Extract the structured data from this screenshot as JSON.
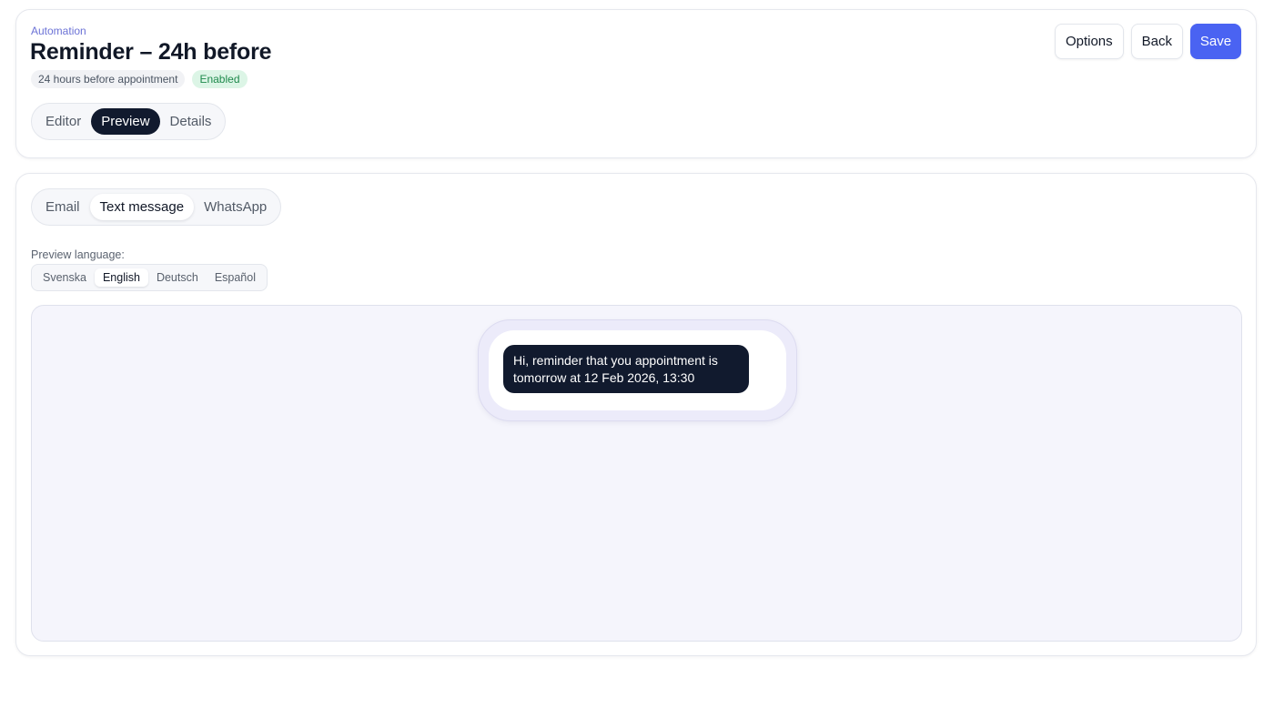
{
  "header": {
    "eyebrow": "Automation",
    "title": "Reminder – 24h before",
    "timing_chip": "24 hours before appointment",
    "status_badge": "Enabled",
    "view_tabs": [
      {
        "label": "Editor",
        "active": false
      },
      {
        "label": "Preview",
        "active": true
      },
      {
        "label": "Details",
        "active": false
      }
    ],
    "actions": {
      "options_label": "Options",
      "back_label": "Back",
      "save_label": "Save"
    }
  },
  "preview": {
    "channel_tabs": [
      {
        "label": "Email",
        "active": false
      },
      {
        "label": "Text message",
        "active": true
      },
      {
        "label": "WhatsApp",
        "active": false
      }
    ],
    "language_label": "Preview language:",
    "languages": [
      {
        "label": "Svenska",
        "active": false
      },
      {
        "label": "English",
        "active": true
      },
      {
        "label": "Deutsch",
        "active": false
      },
      {
        "label": "Español",
        "active": false
      }
    ],
    "message_text": "Hi, reminder that you appointment is tomorrow at 12 Feb 2026, 13:30"
  },
  "colors": {
    "primary": "#4a63f2",
    "dark": "#111a2e",
    "enabled_bg": "#dcf5e6",
    "enabled_text": "#1f8a4c",
    "eyebrow": "#6b72d6"
  }
}
